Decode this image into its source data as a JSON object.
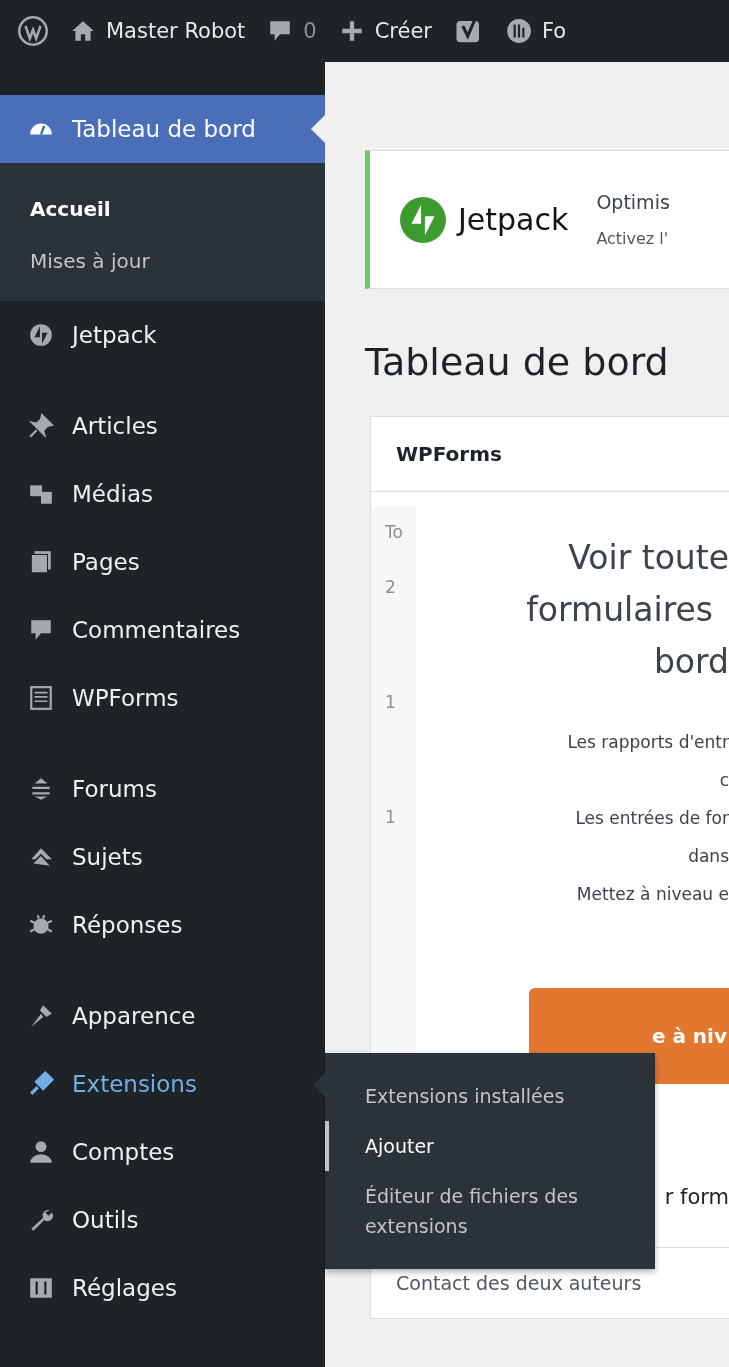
{
  "admin_bar": {
    "site": "Master Robot",
    "comments": "0",
    "new": "Créer",
    "cut_item": "Fo"
  },
  "sidebar": {
    "groups": [
      [
        {
          "label": "Tableau de bord",
          "selected": true,
          "hovered": false,
          "submenu": [
            {
              "label": "Accueil",
              "selected": true
            },
            {
              "label": "Mises à jour",
              "selected": false
            }
          ]
        },
        {
          "label": "Jetpack",
          "selected": false,
          "hovered": false
        }
      ],
      [
        {
          "label": "Articles",
          "selected": false,
          "hovered": false
        },
        {
          "label": "Médias",
          "selected": false,
          "hovered": false
        },
        {
          "label": "Pages",
          "selected": false,
          "hovered": false
        },
        {
          "label": "Commentaires",
          "selected": false,
          "hovered": false
        },
        {
          "label": "WPForms",
          "selected": false,
          "hovered": false
        }
      ],
      [
        {
          "label": "Forums",
          "selected": false,
          "hovered": false
        },
        {
          "label": "Sujets",
          "selected": false,
          "hovered": false
        },
        {
          "label": "Réponses",
          "selected": false,
          "hovered": false
        }
      ],
      [
        {
          "label": "Apparence",
          "selected": false,
          "hovered": false
        },
        {
          "label": "Extensions",
          "selected": false,
          "hovered": true
        },
        {
          "label": "Comptes",
          "selected": false,
          "hovered": false
        },
        {
          "label": "Outils",
          "selected": false,
          "hovered": false
        },
        {
          "label": "Réglages",
          "selected": false,
          "hovered": false
        }
      ]
    ]
  },
  "flyout": {
    "items": [
      {
        "label": "Extensions installées",
        "selected": false
      },
      {
        "label": "Ajouter",
        "selected": true
      },
      {
        "label": "Éditeur de fichiers des extensions",
        "selected": false
      }
    ]
  },
  "notice": {
    "brand": "Jetpack",
    "title": "Optimis",
    "text": "Activez l'"
  },
  "page_title": "Tableau de bord",
  "widget": {
    "title": "WPForms",
    "chart_ghost": [
      "To",
      "2",
      "1",
      "1"
    ],
    "heading": [
      "Voir toute",
      "formulaires",
      "bord"
    ],
    "lines": [
      "Les rapports d'entr",
      "c",
      "Les entrées de for",
      "dans",
      "Mettez à niveau e"
    ],
    "button": "e à niv",
    "section": "r form",
    "row": "Contact des deux auteurs"
  }
}
